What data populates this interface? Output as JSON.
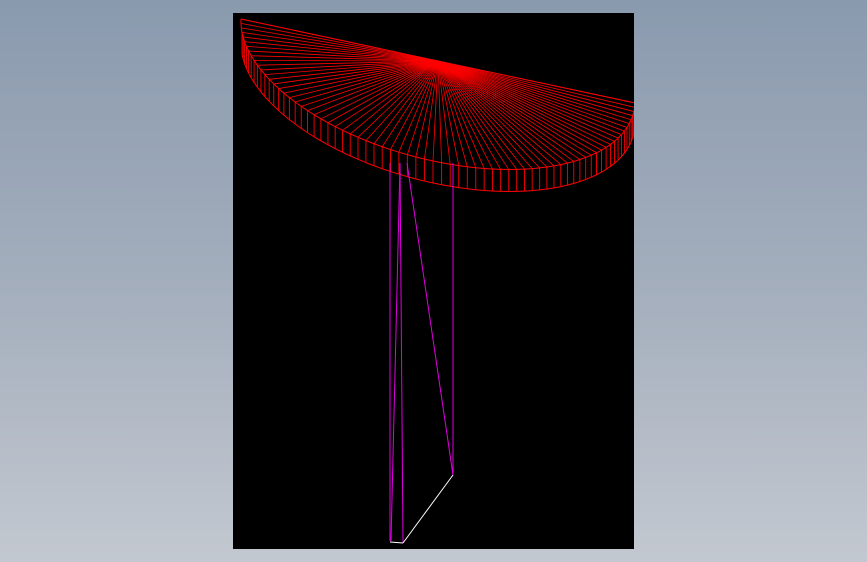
{
  "scene": {
    "description_visible_text": "",
    "background_color": "#8fa0b4",
    "viewport_color": "#000000",
    "tabletop_color": "#ff0000",
    "leg_color": "#e000e0",
    "base_edge_color": "#ffffff",
    "tabletop_segments": 72,
    "tabletop_thickness_divisions": 1
  }
}
